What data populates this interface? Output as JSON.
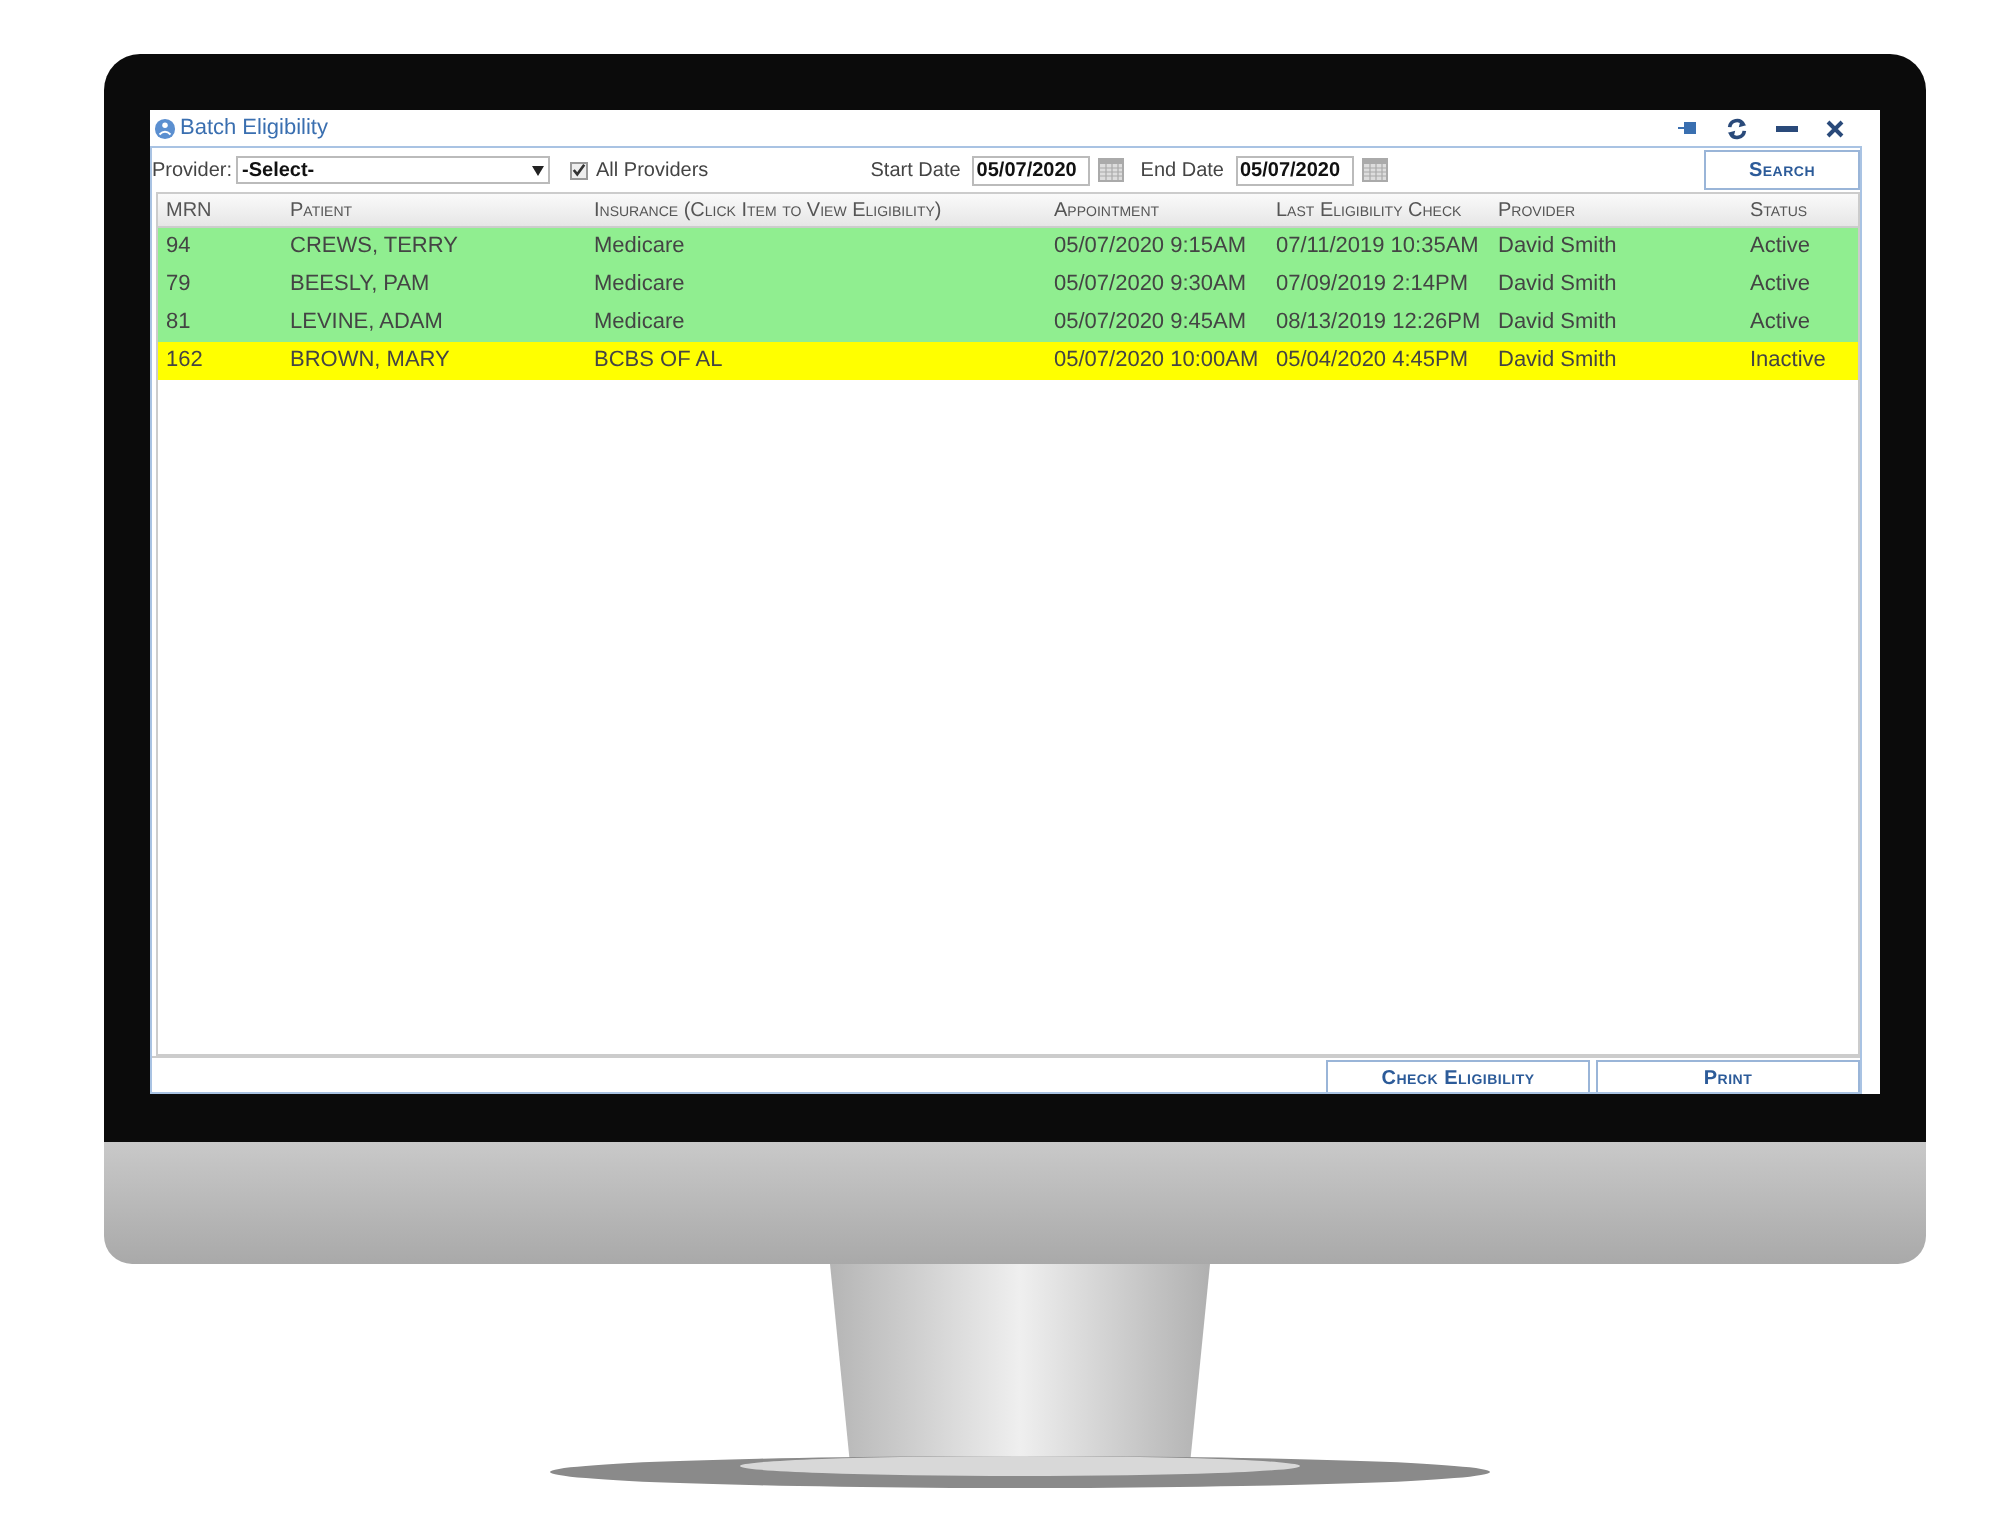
{
  "window": {
    "title": "Batch Eligibility"
  },
  "toolbar": {
    "provider_label": "Provider:",
    "provider_select": "-Select-",
    "all_providers": {
      "label": "All Providers",
      "checked": true
    },
    "start_date": {
      "label": "Start Date",
      "value": "05/07/2020"
    },
    "end_date": {
      "label": "End Date",
      "value": "05/07/2020"
    },
    "search_button": "Search"
  },
  "table": {
    "columns": [
      "MRN",
      "Patient",
      "Insurance (Click Item to View Eligibility)",
      "Appointment",
      "Last Eligibility Check",
      "Provider",
      "Status"
    ],
    "rows": [
      {
        "cells": [
          "94",
          "CREWS, TERRY",
          "Medicare",
          "05/07/2020 9:15AM",
          "07/11/2019 10:35AM",
          "David Smith",
          "Active"
        ],
        "color": "#90ee90"
      },
      {
        "cells": [
          "79",
          "BEESLY, PAM",
          "Medicare",
          "05/07/2020 9:30AM",
          "07/09/2019 2:14PM",
          "David Smith",
          "Active"
        ],
        "color": "#90ee90"
      },
      {
        "cells": [
          "81",
          "LEVINE, ADAM",
          "Medicare",
          "05/07/2020 9:45AM",
          "08/13/2019 12:26PM",
          "David Smith",
          "Active"
        ],
        "color": "#90ee90"
      },
      {
        "cells": [
          "162",
          "BROWN, MARY",
          "BCBS OF AL",
          "05/07/2020 10:00AM",
          "05/04/2020 4:45PM",
          "David Smith",
          "Inactive"
        ],
        "color": "#ffff00"
      }
    ]
  },
  "buttons": [
    "Check Eligibility",
    "Print"
  ]
}
